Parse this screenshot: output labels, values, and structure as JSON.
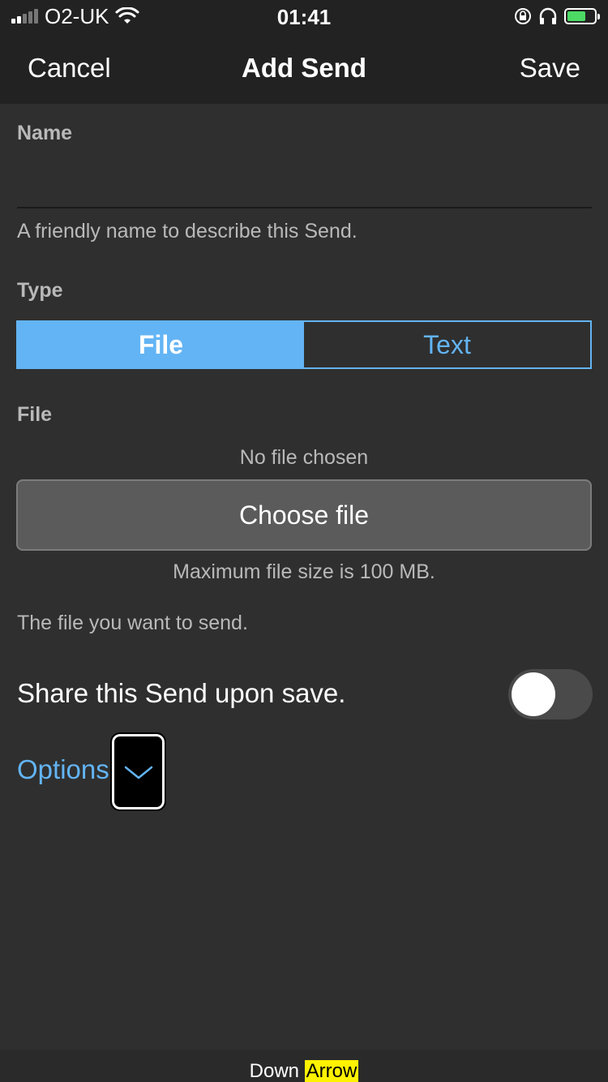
{
  "status_bar": {
    "carrier": "O2-UK",
    "time": "01:41",
    "icons": [
      "signal-icon",
      "wifi-icon",
      "orientation-lock-icon",
      "headphones-icon",
      "battery-icon"
    ]
  },
  "nav": {
    "cancel_label": "Cancel",
    "title": "Add Send",
    "save_label": "Save"
  },
  "form": {
    "name_label": "Name",
    "name_value": "",
    "name_help": "A friendly name to describe this Send.",
    "type_label": "Type",
    "type_options": [
      {
        "label": "File",
        "selected": true
      },
      {
        "label": "Text",
        "selected": false
      }
    ],
    "file_label": "File",
    "no_file_text": "No file chosen",
    "choose_file_label": "Choose file",
    "max_size_text": "Maximum file size is 100 MB.",
    "file_help": "The file you want to send.",
    "share_label": "Share this Send upon save.",
    "share_enabled": false,
    "options_label": "Options"
  },
  "caption": {
    "word1": "Down",
    "word2": "Arrow"
  },
  "colors": {
    "accent": "#63b4f4",
    "background": "#2f2f2f",
    "bar": "#222222",
    "muted_text": "#b9b9b9",
    "caption_highlight": "#fff200"
  }
}
